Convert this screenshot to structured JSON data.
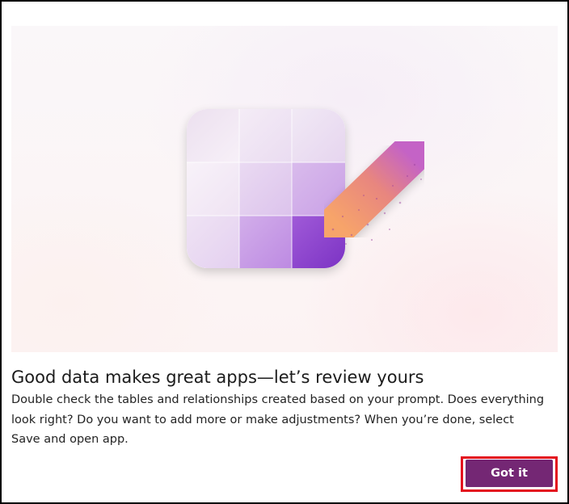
{
  "dialog": {
    "title": "Good data makes great apps—let’s review yours",
    "description": "Double check the tables and relationships created based on your prompt. Does everything look right? Do you want to add more or make adjustments? When you’re done, select Save and open app.",
    "primary_button_label": "Got it"
  },
  "illustration": {
    "icon": "table-grid-pencil-illustration",
    "colors": {
      "grid_light": "#f3eaf6",
      "grid_mid": "#dcbdec",
      "grid_dark": "#8a3fd0",
      "pencil_start": "#f7a46a",
      "pencil_end": "#c463c6"
    }
  },
  "colors": {
    "primary_button": "#742774",
    "highlight_border": "#e3101e"
  }
}
